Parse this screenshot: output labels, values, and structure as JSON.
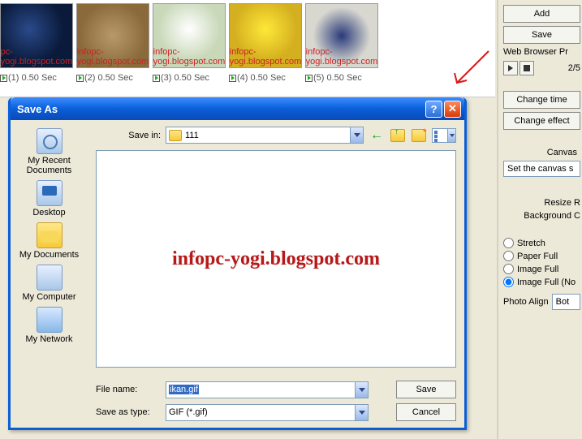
{
  "thumbs": [
    {
      "caption": "(1) 0.50 Sec",
      "credit": "pc-yogi.blogspot.com"
    },
    {
      "caption": "(2) 0.50 Sec",
      "credit": "infopc-yogi.blogspot.com"
    },
    {
      "caption": "(3) 0.50 Sec",
      "credit": "infopc-yogi.blogspot.com"
    },
    {
      "caption": "(4) 0.50 Sec",
      "credit": "infopc-yogi.blogspot.com"
    },
    {
      "caption": "(5) 0.50 Sec",
      "credit": "infopc-yogi.blogspot.com"
    }
  ],
  "right": {
    "add": "Add",
    "save": "Save",
    "browser": "Web Browser Pr",
    "progress": "2/5",
    "change_time": "Change time",
    "change_effect": "Change effect",
    "canvas_label": "Canvas",
    "canvas_note": "Set the canvas s",
    "resize": "Resize R",
    "bgcolor": "Background C",
    "opt_stretch": "Stretch",
    "opt_paperfull": "Paper Full",
    "opt_imagefull": "Image Full",
    "opt_imagefullno": "Image Full (No",
    "photo_align_label": "Photo Align",
    "photo_align_value": "Bot"
  },
  "dialog": {
    "title": "Save As",
    "savein_label": "Save in:",
    "savein_value": "111",
    "places": {
      "recent": "My Recent Documents",
      "desktop": "Desktop",
      "mydocs": "My Documents",
      "mycomputer": "My Computer",
      "mynetwork": "My Network"
    },
    "watermark": "infopc-yogi.blogspot.com",
    "filename_label": "File name:",
    "filename_value": "ikan.gif",
    "saveastype_label": "Save as type:",
    "saveastype_value": "GIF (*.gif)",
    "save_btn": "Save",
    "cancel_btn": "Cancel"
  }
}
